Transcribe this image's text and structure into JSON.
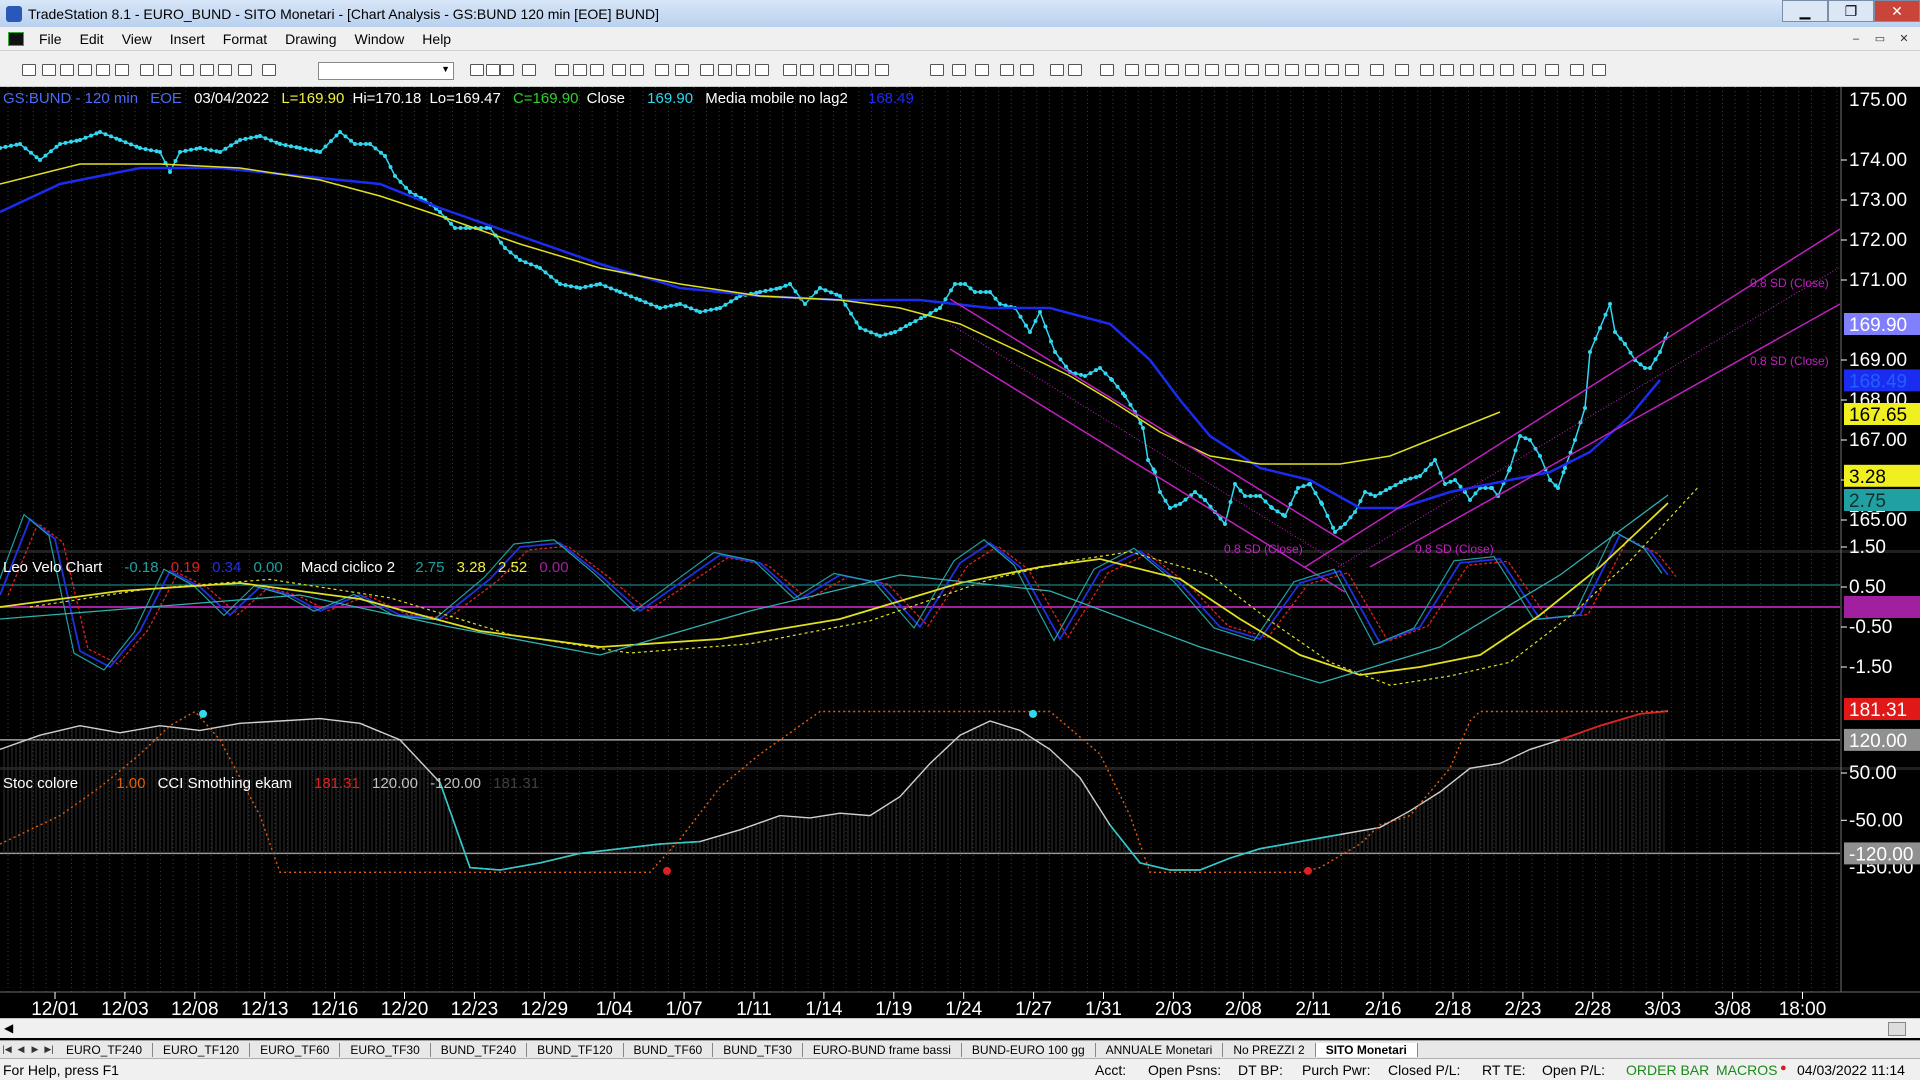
{
  "window": {
    "title": "TradeStation 8.1 - EURO_BUND - SITO Monetari - [Chart Analysis - GS:BUND  120 min  [EOE] BUND]"
  },
  "menu": [
    "File",
    "Edit",
    "View",
    "Insert",
    "Format",
    "Drawing",
    "Window",
    "Help"
  ],
  "pane1": {
    "symbol": "GS:BUND - 120 min",
    "exchange": "EOE",
    "date": "03/04/2022",
    "last": "L=169.90",
    "hi": "Hi=170.18",
    "lo": "Lo=169.47",
    "close": "C=169.90",
    "close_label": "Close",
    "close_value": "169.90",
    "ma_label": "Media mobile no lag2",
    "ma_value": "168.49",
    "sd_labels": [
      "0.8 SD (Close)",
      "0.8 SD (Close)",
      "0.8 SD (Close)",
      "0.8 SD (Close)"
    ],
    "price_ticks": [
      "174.00",
      "173.00",
      "172.00",
      "171.00",
      "169.00",
      "168.00",
      "167.00",
      "166.00",
      "165.00"
    ],
    "top_tick_partial": "175.00",
    "badges": {
      "last": "169.90",
      "ma_blue": "168.49",
      "ma_yellow": "167.65"
    }
  },
  "pane2": {
    "name": "Leo Velo Chart",
    "values": [
      "-0.18",
      "0.19",
      "0.34",
      "0.00"
    ],
    "name2": "Macd ciclico 2",
    "values2": [
      "2.75",
      "3.28",
      "2.52",
      "0.00"
    ],
    "ticks": [
      "1.50",
      "0.50",
      "-0.50",
      "-1.50"
    ],
    "partial_tick": "2.52",
    "badges": {
      "yellow": "3.28",
      "teal": "2.75",
      "purple": "0.00"
    }
  },
  "pane3": {
    "name": "Stoc colore",
    "value": "1.00",
    "name2": "CCI Smothing ekam",
    "values2": [
      "181.31",
      "120.00",
      "-120.00",
      "181.31"
    ],
    "ticks": [
      "50.00",
      "-50.00"
    ],
    "partial_tick": "-150.00",
    "badges": {
      "red": "181.31",
      "upper": "120.00",
      "lower": "-120.00"
    }
  },
  "xaxis": [
    "12/01",
    "12/03",
    "12/08",
    "12/13",
    "12/16",
    "12/20",
    "12/23",
    "12/29",
    "1/04",
    "1/07",
    "1/11",
    "1/14",
    "1/19",
    "1/24",
    "1/27",
    "1/31",
    "2/03",
    "2/08",
    "2/11",
    "2/16",
    "2/18",
    "2/23",
    "2/28",
    "3/03",
    "3/08",
    "18:00"
  ],
  "workspace_tabs": [
    "EURO_TF240",
    "EURO_TF120",
    "EURO_TF60",
    "EURO_TF30",
    "BUND_TF240",
    "BUND_TF120",
    "BUND_TF60",
    "BUND_TF30",
    "EURO-BUND frame bassi",
    "BUND-EURO 100 gg",
    "ANNUALE Monetari",
    "No PREZZI 2",
    "SITO Monetari"
  ],
  "status": {
    "help": "For Help, press F1",
    "acct": "Acct:",
    "open_psns": "Open Psns:",
    "dt_bp": "DT BP:",
    "purch_pwr": "Purch Pwr:",
    "closed_pl": "Closed P/L:",
    "rt_te": "RT TE:",
    "open_pl": "Open P/L:",
    "order_bar": "ORDER BAR",
    "macros": "MACROS",
    "datetime": "04/03/2022 11:14"
  },
  "colors": {
    "price_dots": "#30d8f0",
    "ma_blue": "#1a2cf0",
    "ma_yellow": "#e0e020",
    "channel": "#c020c0",
    "leo_red": "#e02020",
    "leo_blue": "#2030e0",
    "leo_teal": "#20a0a0",
    "cci_orange": "#e06010",
    "stoc_line": "#d0d0d0"
  }
}
